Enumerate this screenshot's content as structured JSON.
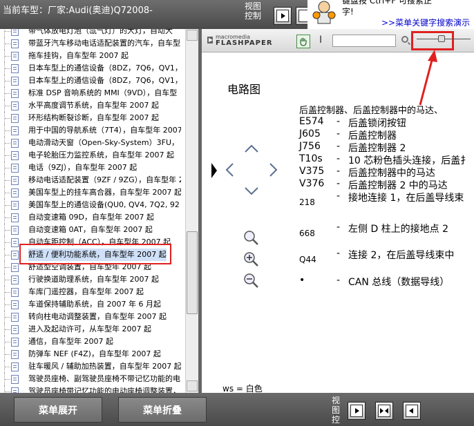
{
  "header": {
    "car_label": "当前车型：厂家:Audi(奥迪)Q72008-",
    "view_control_label": "视图控制"
  },
  "ad": {
    "line1": "键盘按 Ctrl+F 可搜索正",
    "line2": "字!",
    "link": ">>菜单关键字搜索演示"
  },
  "tree": {
    "items": [
      {
        "label": "带气体放电灯泡（氙气灯）的大灯，自动大"
      },
      {
        "label": "带蓝牙汽车移动电话适配装置的汽车，自车型"
      },
      {
        "label": "拖车挂钩，自车型年 2007 起"
      },
      {
        "label": "日本车型上的通信设备（8DZ，7Q6，QV1，"
      },
      {
        "label": "日本车型上的通信设备（8DZ，7Q6，QV1，"
      },
      {
        "label": "标准 DSP 音响系统的 MMI（9VD），自车型"
      },
      {
        "label": "水平高度调节系统，自车型年 2007 起"
      },
      {
        "label": "环形结构断裂诊断，自车型年 2007 起"
      },
      {
        "label": "用于中国的导航系统（7T4），自车型年 2007"
      },
      {
        "label": "电动滑动天窗（Open-Sky-System）3FU，"
      },
      {
        "label": "电子轮胎压力监控系统，自车型年 2007 起"
      },
      {
        "label": "电话（9ZJ），自车型年 2007 起"
      },
      {
        "label": "移动电话适配装置（9ZF / 9ZG），自车型年 2"
      },
      {
        "label": "美国车型上的挂车高合器，自车型年 2007 起"
      },
      {
        "label": "美国车型上的通信设备(QU0, QV4, 7Q2, 92"
      },
      {
        "label": "自动变速箱 09D，自车型年 2007 起"
      },
      {
        "label": "自动变速箱 0AT，自车型年 2007 起"
      },
      {
        "label": "自动车距控制（ACC），自车型年 2007 起"
      },
      {
        "label": "舒适 / 便利功能系统，自车型年 2007 起",
        "selected": true
      },
      {
        "label": "舒适型空调装置，自车型年 2007 起"
      },
      {
        "label": "行驶换道助理系统，自车型年 2007 起"
      },
      {
        "label": "车库门遥控器，自车型年 2007 起"
      },
      {
        "label": "车道保持辅助系统，自 2007 年 6 月起"
      },
      {
        "label": "转向柱电动调整装置，自车型年 2007 起"
      },
      {
        "label": "进入及起动许可，从车型年 2007 起"
      },
      {
        "label": "通信，自车型年 2007 起"
      },
      {
        "label": "防弹车 NEF (F4Z)，自车型年 2007 起"
      },
      {
        "label": "驻车暖风 / 辅助加热装置，自车型年 2007 起"
      },
      {
        "label": "驾驶员座椅、副驾驶员座椅不带记忆功能的电"
      },
      {
        "label": "驾驶员座椅带记忆功能的电动座椅调整装置，"
      }
    ]
  },
  "viewer": {
    "logo_top": "macromedia",
    "logo": "FLASHPAPER",
    "text_tool": "I",
    "zoom_level": 0.45
  },
  "doc": {
    "title": "电路图",
    "heading": "后盖控制器、后盖控制器中的马达、",
    "rows": [
      {
        "code": "E574",
        "dash": "-",
        "desc": "后盖锁闭按钮"
      },
      {
        "code": "J605",
        "dash": "-",
        "desc": "后盖控制器"
      },
      {
        "code": "J756",
        "dash": "-",
        "desc": "后盖控制器 2"
      },
      {
        "code": "T10s",
        "dash": "-",
        "desc": "10 芯粉色插头连接，后盖扌"
      },
      {
        "code": "V375",
        "dash": "-",
        "desc": "后盖控制器中的马达"
      },
      {
        "code": "V376",
        "dash": "-",
        "desc": "后盖控制器 2 中的马达"
      },
      {
        "code": "218",
        "dash": "-",
        "desc": "接地连接 1，在后盖导线束"
      },
      {
        "code": "668",
        "dash": "-",
        "desc": "左侧 D 柱上的接地点 2"
      },
      {
        "code": "Q44",
        "dash": "-",
        "desc": "连接 2，在后盖导线束中"
      },
      {
        "code": "•",
        "dash": "-",
        "desc": "CAN 总线（数据导线）"
      }
    ],
    "footer": "ws = 白色"
  },
  "bottom": {
    "expand": "菜单展开",
    "collapse": "菜单折叠",
    "view_control_label": "视图控"
  }
}
